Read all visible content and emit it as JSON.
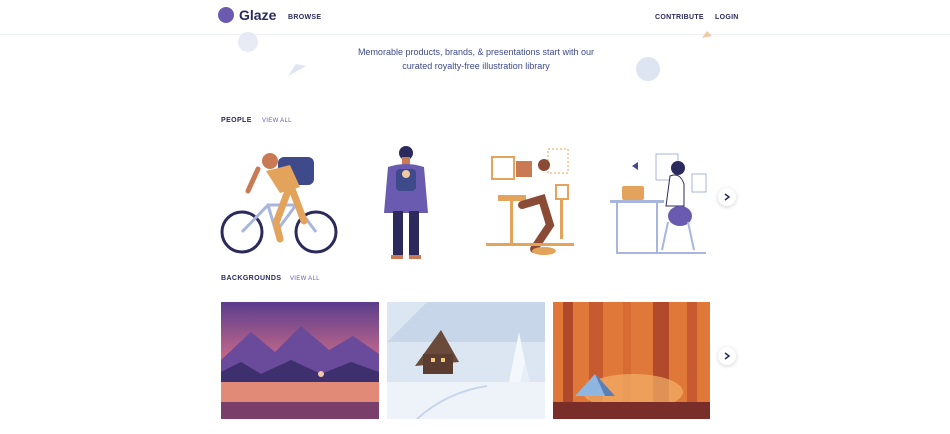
{
  "brand": {
    "name": "Glaze",
    "logo_icon": "circle-logo-icon",
    "color": "#6b5bb0"
  },
  "nav": {
    "browse": "BROWSE",
    "contribute": "CONTRIBUTE",
    "login": "LOGIN"
  },
  "hero": {
    "line1": "Memorable products, brands, & presentations start with our",
    "line2": "curated royalty-free illustration library"
  },
  "sections": {
    "people": {
      "title": "PEOPLE",
      "view_all": "VIEW ALL",
      "cards": [
        {
          "name": "cyclist"
        },
        {
          "name": "parent-with-baby-carrier"
        },
        {
          "name": "person-at-desk-cat"
        },
        {
          "name": "woman-at-laptop"
        }
      ]
    },
    "backgrounds": {
      "title": "BACKGROUNDS",
      "view_all": "VIEW ALL",
      "cards": [
        {
          "name": "sunset-lake"
        },
        {
          "name": "snowy-cabin"
        },
        {
          "name": "forest-campsite"
        }
      ]
    }
  },
  "colors": {
    "text_dark": "#2c2a5c",
    "accent": "#6b5bb0",
    "hero_text": "#3e4a8a"
  }
}
